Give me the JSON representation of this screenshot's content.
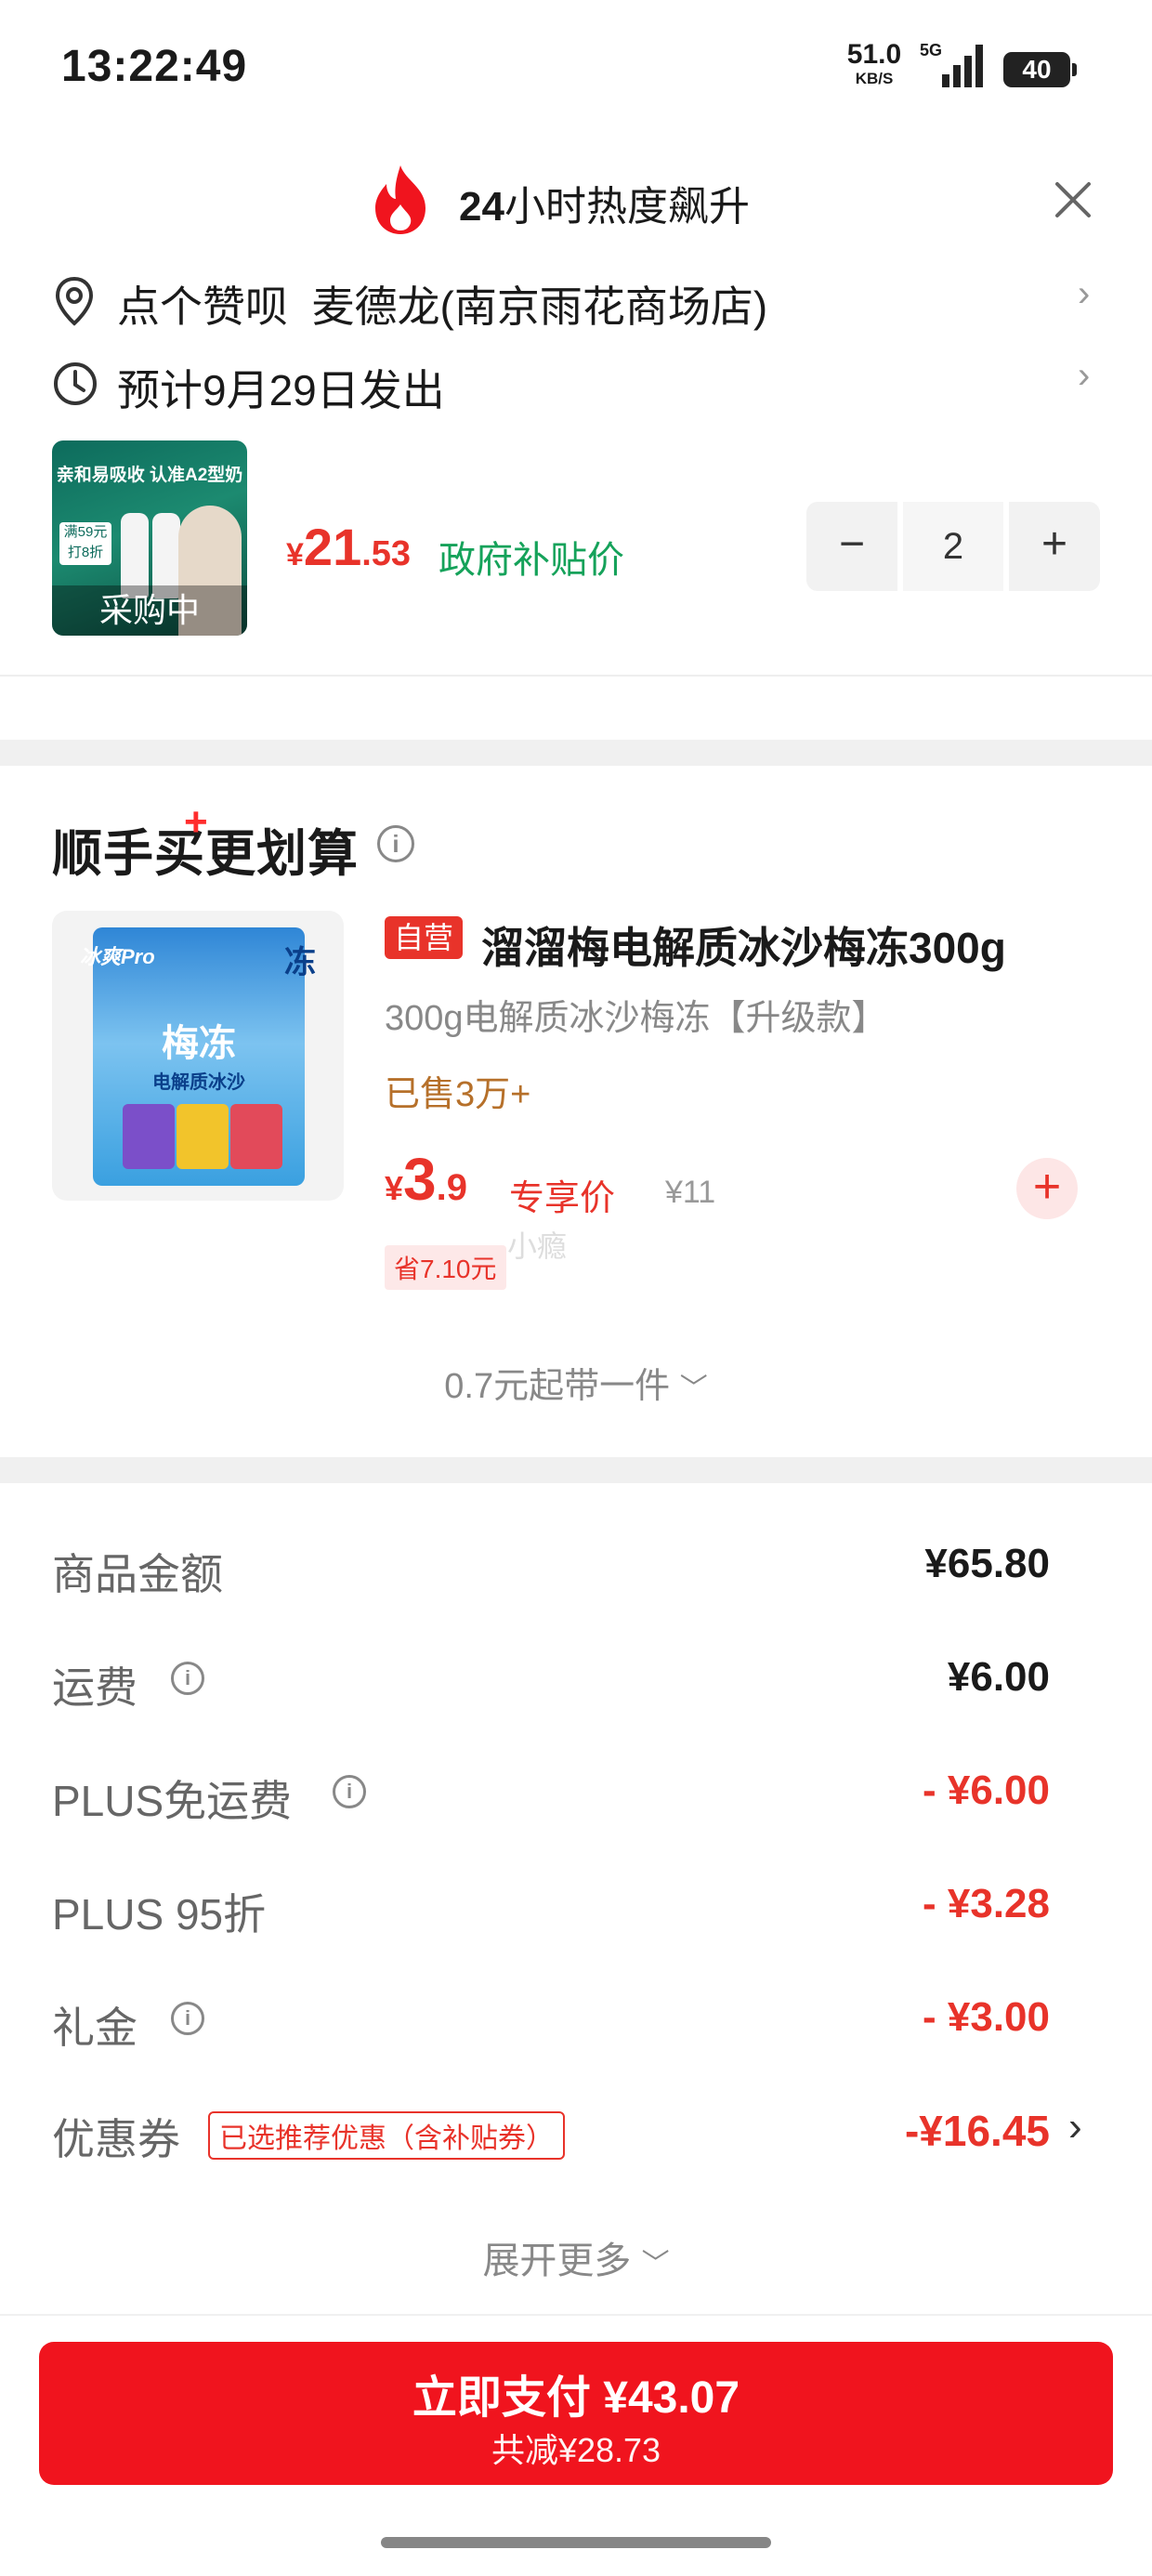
{
  "status_bar": {
    "time": "13:22:49",
    "net_speed": "51.0",
    "net_unit": "KB/S",
    "network": "5G",
    "battery": "40"
  },
  "header": {
    "title_bold": "24",
    "title_rest": "小时热度飙升"
  },
  "address": {
    "text": "点个赞呗  麦德龙(南京雨花商场店)"
  },
  "delivery": {
    "text": "预计9月29日发出"
  },
  "product": {
    "thumb_text": "亲和易吸收 认准A2型奶",
    "thumb_badge": "满59元打8折",
    "status": "采购中",
    "price_currency": "¥",
    "price_int": "21",
    "price_dec": ".53",
    "subsidy_label": "政府补贴价",
    "quantity": "2",
    "minus": "−",
    "plus": "+"
  },
  "addon_section": {
    "title": "顺手买更划算",
    "title_plus": "+",
    "item": {
      "tag": "自营",
      "name": "溜溜梅电解质冰沙梅冻300g",
      "spec": "300g电解质冰沙梅冻【升级款】",
      "sold": "已售3万+",
      "price_currency": "¥",
      "price_int": "3",
      "price_dec": ".9",
      "exclusive": "专享价",
      "original": "¥11",
      "save": "省7.10元",
      "add": "+",
      "bag_brand": "冰爽Pro",
      "bag_title": "梅冻",
      "bag_sub": "电解质冰沙",
      "bag_corner": "冻"
    },
    "watermark": "小瘾",
    "more": "0.7元起带一件"
  },
  "summary": {
    "rows": [
      {
        "label": "商品金额",
        "amount": "¥65.80"
      },
      {
        "label": "运费",
        "amount": "¥6.00"
      },
      {
        "label": "PLUS免运费",
        "amount": "- ¥6.00"
      },
      {
        "label": "PLUS 95折",
        "amount": "- ¥3.28"
      },
      {
        "label": "礼金",
        "amount": "- ¥3.00"
      }
    ],
    "coupon": {
      "label": "优惠券",
      "tag": "已选推荐优惠（含补贴券）",
      "amount": "-¥16.45"
    },
    "expand": "展开更多"
  },
  "pay": {
    "main": "立即支付 ¥43.07",
    "sub": "共减¥28.73"
  },
  "colors": {
    "accent_red": "#e8332a",
    "pay_red": "#f0141e",
    "green": "#15a25a",
    "sold_brown": "#b6702a"
  }
}
